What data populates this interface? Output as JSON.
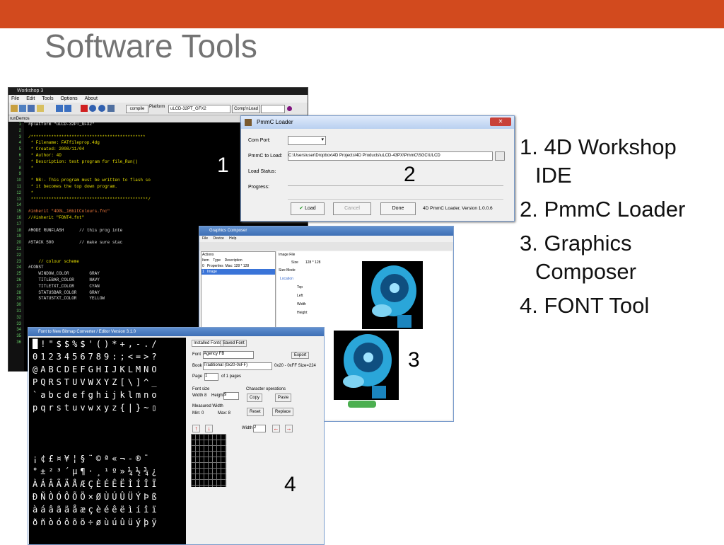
{
  "slide": {
    "title": "Software Tools",
    "accent_color": "#D24A1E",
    "items": [
      "1. 4D Workshop IDE",
      "2. PmmC Loader",
      "3. Graphics Composer",
      "4. FONT Tool"
    ]
  },
  "workshop": {
    "title": "Workshop 3",
    "menu": [
      "File",
      "Edit",
      "Tools",
      "Options",
      "About"
    ],
    "compile_label": "compile",
    "platform_label": "Platform",
    "platform_value": "uLCD-32PT_GFX2",
    "comp_load_label": "Comp'nLoad",
    "tab_label": "runDemos",
    "line_numbers": [
      "1",
      "2",
      "3",
      "4",
      "5",
      "6",
      "7",
      "8",
      "9",
      "10",
      "11",
      "12",
      "13",
      "14",
      "15",
      "16",
      "17",
      "18",
      "19",
      "20",
      "21",
      "22",
      "23",
      "24",
      "25",
      "26",
      "27",
      "28",
      "29",
      "30",
      "31",
      "32",
      "33",
      "34",
      "35",
      "36"
    ],
    "code_lines": [
      {
        "text": "#platform \"uLCD-32PT_GFX2\"",
        "color": "#e0e0e0"
      },
      {
        "text": "",
        "color": "#fff"
      },
      {
        "text": "/*********************************************",
        "color": "#e8e000"
      },
      {
        "text": " * Filename: FATfileprop.4dg",
        "color": "#e8e000"
      },
      {
        "text": " * Created: 2008/11/04",
        "color": "#e8e000"
      },
      {
        "text": " * Author: 4D",
        "color": "#e8e000"
      },
      {
        "text": " * Description: test program for file_Run()",
        "color": "#e8e000"
      },
      {
        "text": " *",
        "color": "#e8e000"
      },
      {
        "text": "",
        "color": "#fff"
      },
      {
        "text": " * NB:- This program must be written to flash so",
        "color": "#e8e000"
      },
      {
        "text": " * it becomes the top down program.",
        "color": "#e8e000"
      },
      {
        "text": " *",
        "color": "#e8e000"
      },
      {
        "text": " **********************************************/",
        "color": "#e8e000"
      },
      {
        "text": "",
        "color": "#fff"
      },
      {
        "text": "#inherit \"4DGL_16bitColours.fnc\"",
        "color": "#ff8040"
      },
      {
        "text": "//#inherit \"FONT4.fnt\"",
        "color": "#e8e000"
      },
      {
        "text": "",
        "color": "#fff"
      },
      {
        "text": "#MODE RUNFLASH      // this prog inte",
        "color": "#e0e0e0"
      },
      {
        "text": "",
        "color": "#fff"
      },
      {
        "text": "#STACK 500          // make sure stac",
        "color": "#e0e0e0"
      },
      {
        "text": "",
        "color": "#fff"
      },
      {
        "text": "",
        "color": "#fff"
      },
      {
        "text": "    // colour scheme",
        "color": "#e8e000"
      },
      {
        "text": "#CONST",
        "color": "#e0e0e0"
      },
      {
        "text": "    WINDOW_COLOR        GRAY",
        "color": "#e0e0e0"
      },
      {
        "text": "    TITLEBAR_COLOR      NAVY",
        "color": "#e0e0e0"
      },
      {
        "text": "    TITLETXT_COLOR      CYAN",
        "color": "#e0e0e0"
      },
      {
        "text": "    STATUSBAR_COLOR     GRAY",
        "color": "#e0e0e0"
      },
      {
        "text": "    STATUSTXT_COLOR     YELLOW",
        "color": "#e0e0e0"
      }
    ],
    "callout": "1"
  },
  "pmmc": {
    "title": "PmmC Loader",
    "comport_label": "Com Port:",
    "pmmc_label": "PmmC to Load:",
    "pmmc_value": "C:\\Users\\user\\Dropbox\\4D Projects\\4D Products\\uLCD-43PX\\PmmC\\SGC\\ULCD",
    "status_label": "Load Status:",
    "progress_label": "Progress:",
    "load_label": "Load",
    "cancel_label": "Cancel",
    "done_label": "Done",
    "version": "4D PmmC Loader, Version 1.0.0.6",
    "callout": "2"
  },
  "graphics": {
    "title": "Graphics Composer",
    "menu": [
      "File",
      "Device",
      "Help"
    ],
    "actions_label": "Actions",
    "cols": [
      "Item",
      "Type",
      "Description"
    ],
    "rows": [
      [
        "0",
        "Properties",
        "Max: 128 * 128"
      ],
      [
        "1",
        "Image",
        ""
      ]
    ],
    "image_file_label": "Image File",
    "size_label": "Size",
    "size_value": "128 * 128",
    "size_mode_label": "Size Mode",
    "location_label": "Location",
    "top_label": "Top",
    "left_label": "Left",
    "width_label": "Width",
    "height_label": "Height",
    "callout": "3"
  },
  "fonttool": {
    "title": "Font to New Bitmap Converter / Editor Version 3.1.0",
    "glyph_rows": [
      "█!\"$$%$'()*+,-./",
      "0123456789:;<=>?",
      "@ABCDEFGHIJKLMNO",
      "PQRSTUVWXYZ[\\]^_",
      "`abcdefghijklmno",
      "pqrstuvwxyz{|}~▯",
      "",
      "",
      "",
      "¡¢£¤¥¦§¨©ª«¬-®¯",
      "°±²³´µ¶·¸¹º»¼½¾¿",
      "ÀÁÂÃÄÅÆÇÈÉÊËÌÍÎÏ",
      "ÐÑÒÓÔÕÖ×ØÙÚÛÜÝÞß",
      "àáâãäåæçèéêëìíîï",
      "ðñòóôõö÷øùúûüýþÿ"
    ],
    "tab_installed": "Installed Fonts",
    "tab_saved": "Saved Font",
    "font_label": "Font",
    "font_value": "Agency FB",
    "export_label": "Export",
    "book_label": "Book",
    "book_value": "Traditional (0x20-0xFF)",
    "range_value": "0x20 - 0xFF Size=224",
    "page_label": "Page",
    "page_value": "1",
    "of_pages": "of 1 pages",
    "font_size_label": "Font size",
    "width_label": "Width",
    "width_value": "8",
    "height_label": "Height",
    "height_value": "9",
    "measured_label": "Measured Width",
    "min_label": "Min: 0",
    "max_label": "Max: 8",
    "char_ops_label": "Character operations",
    "copy_label": "Copy",
    "paste_label": "Paste",
    "reset_label": "Reset",
    "replace_label": "Replace",
    "width2_label": "Width",
    "width2_value": "2",
    "callout": "4"
  }
}
